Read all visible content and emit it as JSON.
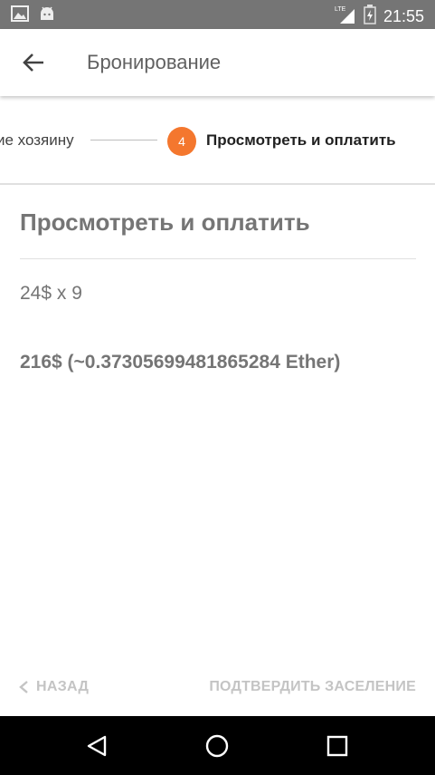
{
  "status_bar": {
    "time": "21:55",
    "network_label": "LTE",
    "icons": [
      "image-icon",
      "android-icon",
      "signal-icon",
      "battery-icon"
    ]
  },
  "app_bar": {
    "title": "Бронирование",
    "back_icon": "arrow-back-icon"
  },
  "stepper": {
    "previous_step_label": "ие хозяину",
    "current_step_number": "4",
    "current_step_label": "Просмотреть и оплатить",
    "accent_color": "#f4772e"
  },
  "content": {
    "title": "Просмотреть и оплатить",
    "price_line": "24$ x 9",
    "total_line": "216$ (~0.37305699481865284 Ether)"
  },
  "footer": {
    "back_label": "НАЗАД",
    "confirm_label": "ПОДТВЕРДИТЬ ЗАСЕЛЕНИЕ"
  },
  "nav_bar": {
    "icons": [
      "back-triangle-icon",
      "home-circle-icon",
      "recents-square-icon"
    ]
  }
}
